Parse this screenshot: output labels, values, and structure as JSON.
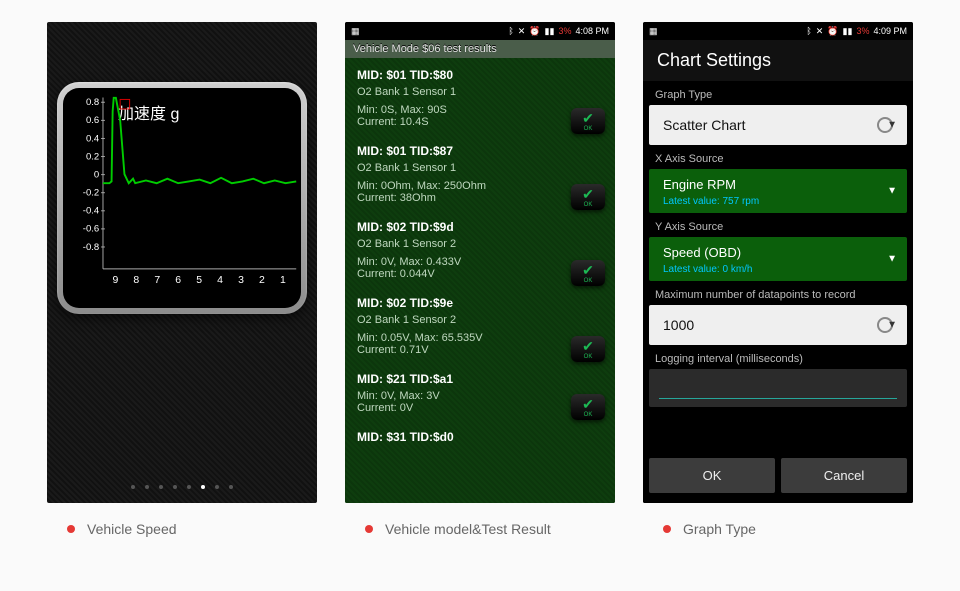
{
  "captions": [
    "Vehicle Speed",
    "Vehicle model&Test Result",
    "Graph Type"
  ],
  "gauge": {
    "title": "加速度 g",
    "y_ticks": [
      "0.8",
      "0.6",
      "0.4",
      "0.2",
      "0",
      "-0.2",
      "-0.4",
      "-0.6",
      "-0.8"
    ],
    "x_ticks": [
      "9",
      "8",
      "7",
      "6",
      "5",
      "4",
      "3",
      "2",
      "1"
    ],
    "page_index": 5,
    "page_count": 8
  },
  "statusbar2": {
    "battery": "3%",
    "time": "4:08 PM"
  },
  "statusbar3": {
    "battery": "3%",
    "time": "4:09 PM"
  },
  "results": {
    "title": "Vehicle Mode $06 test results",
    "items": [
      {
        "mid": "MID: $01 TID:$80",
        "sensor": "O2 Bank 1 Sensor 1",
        "range": "Min: 0S, Max: 90S",
        "current": "Current: 10.4S"
      },
      {
        "mid": "MID: $01 TID:$87",
        "sensor": "O2 Bank 1 Sensor 1",
        "range": "Min: 0Ohm, Max: 250Ohm",
        "current": "Current: 38Ohm"
      },
      {
        "mid": "MID: $02 TID:$9d",
        "sensor": "O2 Bank 1 Sensor 2",
        "range": "Min: 0V, Max: 0.433V",
        "current": "Current: 0.044V"
      },
      {
        "mid": "MID: $02 TID:$9e",
        "sensor": "O2 Bank 1 Sensor 2",
        "range": "Min: 0.05V, Max: 65.535V",
        "current": "Current: 0.71V"
      },
      {
        "mid": "MID: $21 TID:$a1",
        "sensor": "",
        "range": "Min: 0V, Max: 3V",
        "current": "Current: 0V"
      },
      {
        "mid": "MID: $31 TID:$d0",
        "sensor": "",
        "range": "",
        "current": ""
      }
    ]
  },
  "settings": {
    "title": "Chart Settings",
    "sections": {
      "graph_type": {
        "label": "Graph Type",
        "value": "Scatter Chart"
      },
      "x_axis": {
        "label": "X Axis Source",
        "value": "Engine RPM",
        "latest": "Latest value: 757 rpm"
      },
      "y_axis": {
        "label": "Y Axis Source",
        "value": "Speed (OBD)",
        "latest": "Latest value: 0 km/h"
      },
      "max_points": {
        "label": "Maximum number of datapoints to record",
        "value": "1000"
      },
      "log_interval": {
        "label": "Logging interval (milliseconds)"
      }
    },
    "buttons": {
      "ok": "OK",
      "cancel": "Cancel"
    }
  },
  "chart_data": {
    "type": "line",
    "title": "加速度 g",
    "xlabel": "",
    "ylabel": "",
    "ylim": [
      -0.9,
      0.9
    ],
    "x": [
      9.5,
      9.3,
      9.2,
      9.1,
      9.05,
      9.0,
      8.9,
      8.7,
      8.5,
      8.3,
      8.1,
      8.0,
      7.5,
      7.0,
      6.5,
      6.0,
      5.5,
      5.0,
      4.5,
      4.0,
      3.5,
      3.0,
      2.5,
      2.0,
      1.5,
      1.0,
      0.5
    ],
    "y": [
      0.0,
      0.0,
      0.0,
      0.02,
      0.8,
      0.95,
      0.95,
      0.7,
      0.1,
      0.0,
      0.05,
      0.0,
      0.03,
      0.0,
      0.05,
      0.0,
      0.02,
      0.04,
      0.0,
      0.06,
      0.0,
      0.02,
      0.05,
      0.0,
      0.03,
      0.0,
      0.02
    ]
  }
}
